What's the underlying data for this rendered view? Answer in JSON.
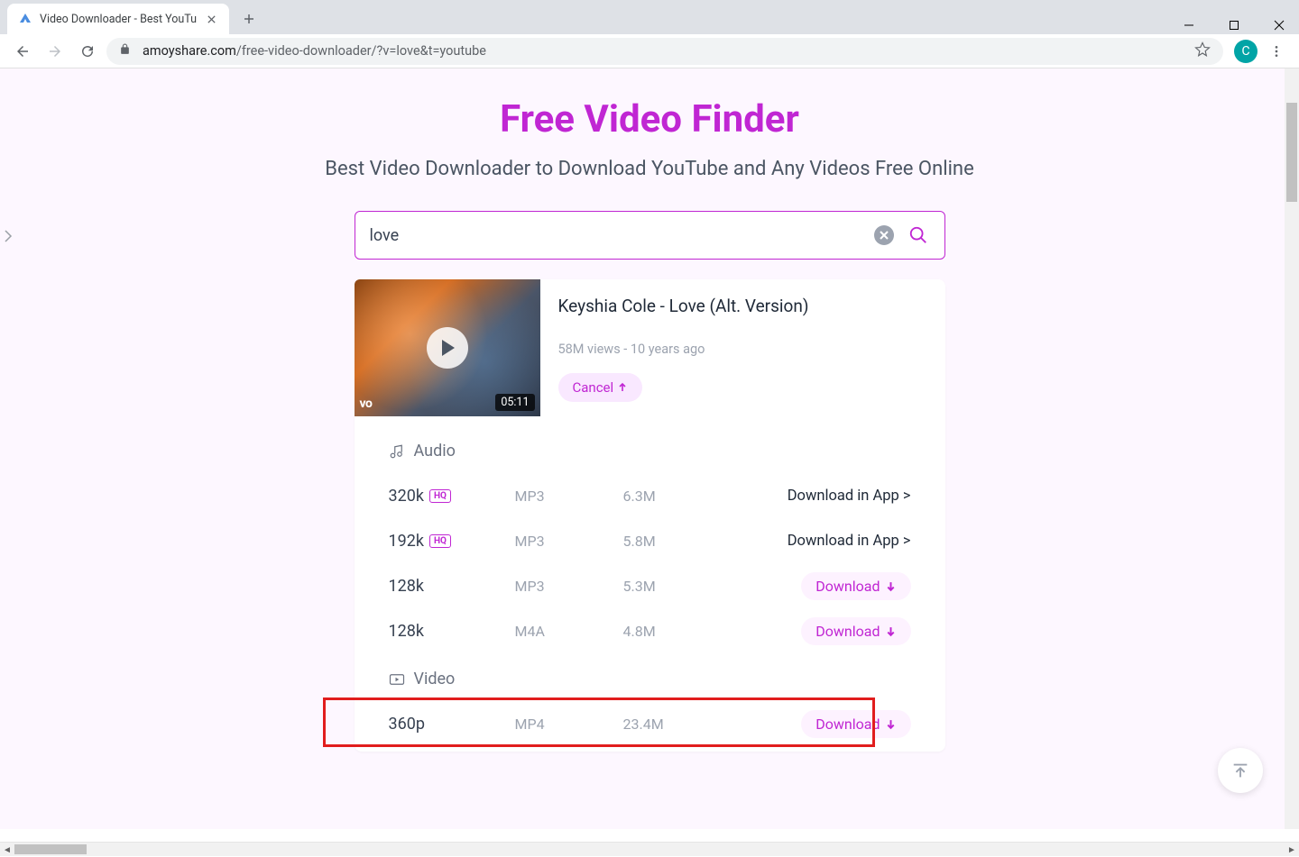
{
  "window": {
    "tab_title": "Video Downloader - Best YouTu",
    "url_domain": "amoyshare.com",
    "url_path": "/free-video-downloader/?v=love&t=youtube",
    "avatar_letter": "C"
  },
  "page": {
    "title": "Free Video Finder",
    "subtitle": "Best Video Downloader to Download YouTube and Any Videos Free Online"
  },
  "search": {
    "value": "love"
  },
  "result": {
    "title": "Keyshia Cole - Love (Alt. Version)",
    "stats": "58M views - 10 years ago",
    "cancel_label": "Cancel",
    "duration": "05:11",
    "vevo": "vo"
  },
  "sections": {
    "audio_label": "Audio",
    "video_label": "Video"
  },
  "audio_rows": [
    {
      "quality": "320k",
      "hq": true,
      "format": "MP3",
      "size": "6.3M",
      "action": "app",
      "action_label": "Download in App >"
    },
    {
      "quality": "192k",
      "hq": true,
      "format": "MP3",
      "size": "5.8M",
      "action": "app",
      "action_label": "Download in App >"
    },
    {
      "quality": "128k",
      "hq": false,
      "format": "MP3",
      "size": "5.3M",
      "action": "download",
      "action_label": "Download"
    },
    {
      "quality": "128k",
      "hq": false,
      "format": "M4A",
      "size": "4.8M",
      "action": "download",
      "action_label": "Download"
    }
  ],
  "video_rows": [
    {
      "quality": "360p",
      "format": "MP4",
      "size": "23.4M",
      "action": "download",
      "action_label": "Download"
    }
  ],
  "labels": {
    "hq": "HQ"
  }
}
